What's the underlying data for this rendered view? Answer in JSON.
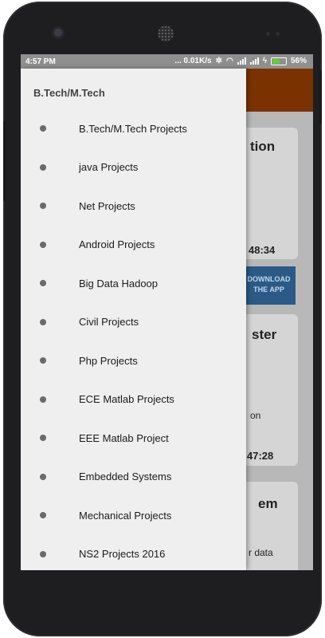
{
  "statusbar": {
    "time": "4:57 PM",
    "network_speed": "... 0.01K/s",
    "battery_percent": "56%",
    "battery_level": 0.56
  },
  "background_app": {
    "card1_title_fragment": "tion",
    "card1_time_fragment": "48:34",
    "banner_line1": "DOWNLOAD",
    "banner_line2": "THE APP",
    "card2_title_fragment": "ster",
    "card2_body_fragment": "on",
    "card2_time_fragment": "47:28",
    "card3_title_fragment": "em",
    "card3_body_fragment": "r data"
  },
  "drawer": {
    "header": "B.Tech/M.Tech",
    "items": [
      {
        "label": "B.Tech/M.Tech Projects"
      },
      {
        "label": "java Projects"
      },
      {
        "label": "Net Projects"
      },
      {
        "label": "Android Projects"
      },
      {
        "label": "Big Data Hadoop"
      },
      {
        "label": "Civil Projects"
      },
      {
        "label": "Php Projects"
      },
      {
        "label": "ECE Matlab Projects"
      },
      {
        "label": "EEE Matlab Project"
      },
      {
        "label": "Embedded Systems"
      },
      {
        "label": "Mechanical Projects"
      },
      {
        "label": "NS2 Projects 2016"
      }
    ]
  },
  "colors": {
    "appbar": "#7a3200",
    "drawer_bg": "#efefef",
    "banner": "#2c5a86"
  }
}
